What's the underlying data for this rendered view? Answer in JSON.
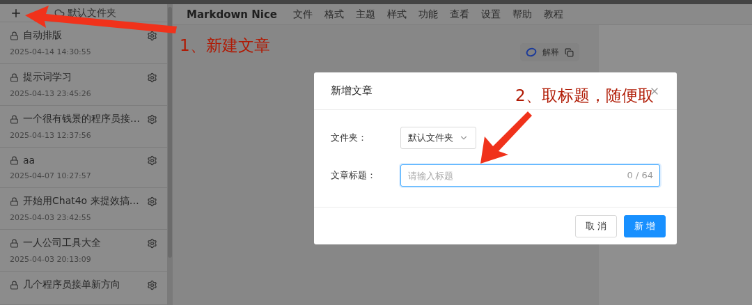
{
  "sidebar": {
    "folder": "默认文件夹",
    "articles": [
      {
        "title": "自动排版",
        "time": "2025-04-14 14:30:55"
      },
      {
        "title": "提示词学习",
        "time": "2025-04-13 23:45:26"
      },
      {
        "title": "一个很有钱景的程序员接…",
        "time": "2025-04-13 12:37:56"
      },
      {
        "title": "aa",
        "time": "2025-04-07 10:27:57"
      },
      {
        "title": "开始用Chat4o 来提效搞…",
        "time": "2025-04-03 23:42:55"
      },
      {
        "title": "一人公司工具大全",
        "time": "2025-04-03 20:13:09"
      },
      {
        "title": "几个程序员接单新方向"
      }
    ]
  },
  "menu": {
    "brand": "Markdown Nice",
    "items": [
      "文件",
      "格式",
      "主题",
      "样式",
      "功能",
      "查看",
      "设置",
      "帮助",
      "教程"
    ]
  },
  "toolbar": {
    "explain": "解释"
  },
  "dialog": {
    "title": "新增文章",
    "fields": [
      {
        "kind": "select",
        "label": "文件夹：",
        "value": "默认文件夹"
      },
      {
        "kind": "input",
        "label": "文章标题：",
        "placeholder": "请输入标题",
        "counter": "0 / 64"
      }
    ],
    "buttons": [
      {
        "label": "取 消",
        "primary": false
      },
      {
        "label": "新 增",
        "primary": true
      }
    ]
  },
  "annotations": [
    "1、新建文章",
    "2、取标题，随便取"
  ]
}
